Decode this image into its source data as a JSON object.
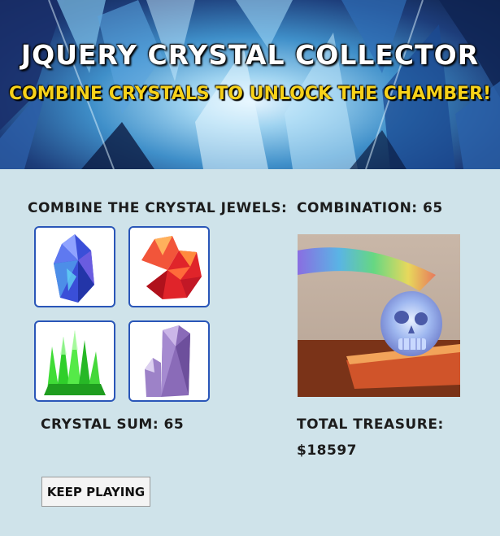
{
  "header": {
    "title": "JQUERY CRYSTAL COLLECTOR",
    "subtitle": "COMBINE CRYSTALS TO UNLOCK THE CHAMBER!"
  },
  "crystals": {
    "section_label": "COMBINE THE CRYSTAL JEWELS:",
    "items": [
      {
        "name": "blue crystal",
        "color": "#3a4fd8"
      },
      {
        "name": "red crystal",
        "color": "#e0242a"
      },
      {
        "name": "green crystal",
        "color": "#2fcf2a"
      },
      {
        "name": "purple crystal",
        "color": "#8a6bb8"
      }
    ],
    "sum_label": "CRYSTAL SUM: 65"
  },
  "target": {
    "combination_label": "COMBINATION: 65",
    "image": "crystal skull with rainbow light"
  },
  "treasure": {
    "label": "TOTAL TREASURE:",
    "value": "$18597"
  },
  "controls": {
    "keep_playing_label": "KEEP PLAYING"
  },
  "colors": {
    "background": "#cfe3ea",
    "crystal_border": "#2a56b8",
    "subtitle": "#f7d21a"
  }
}
